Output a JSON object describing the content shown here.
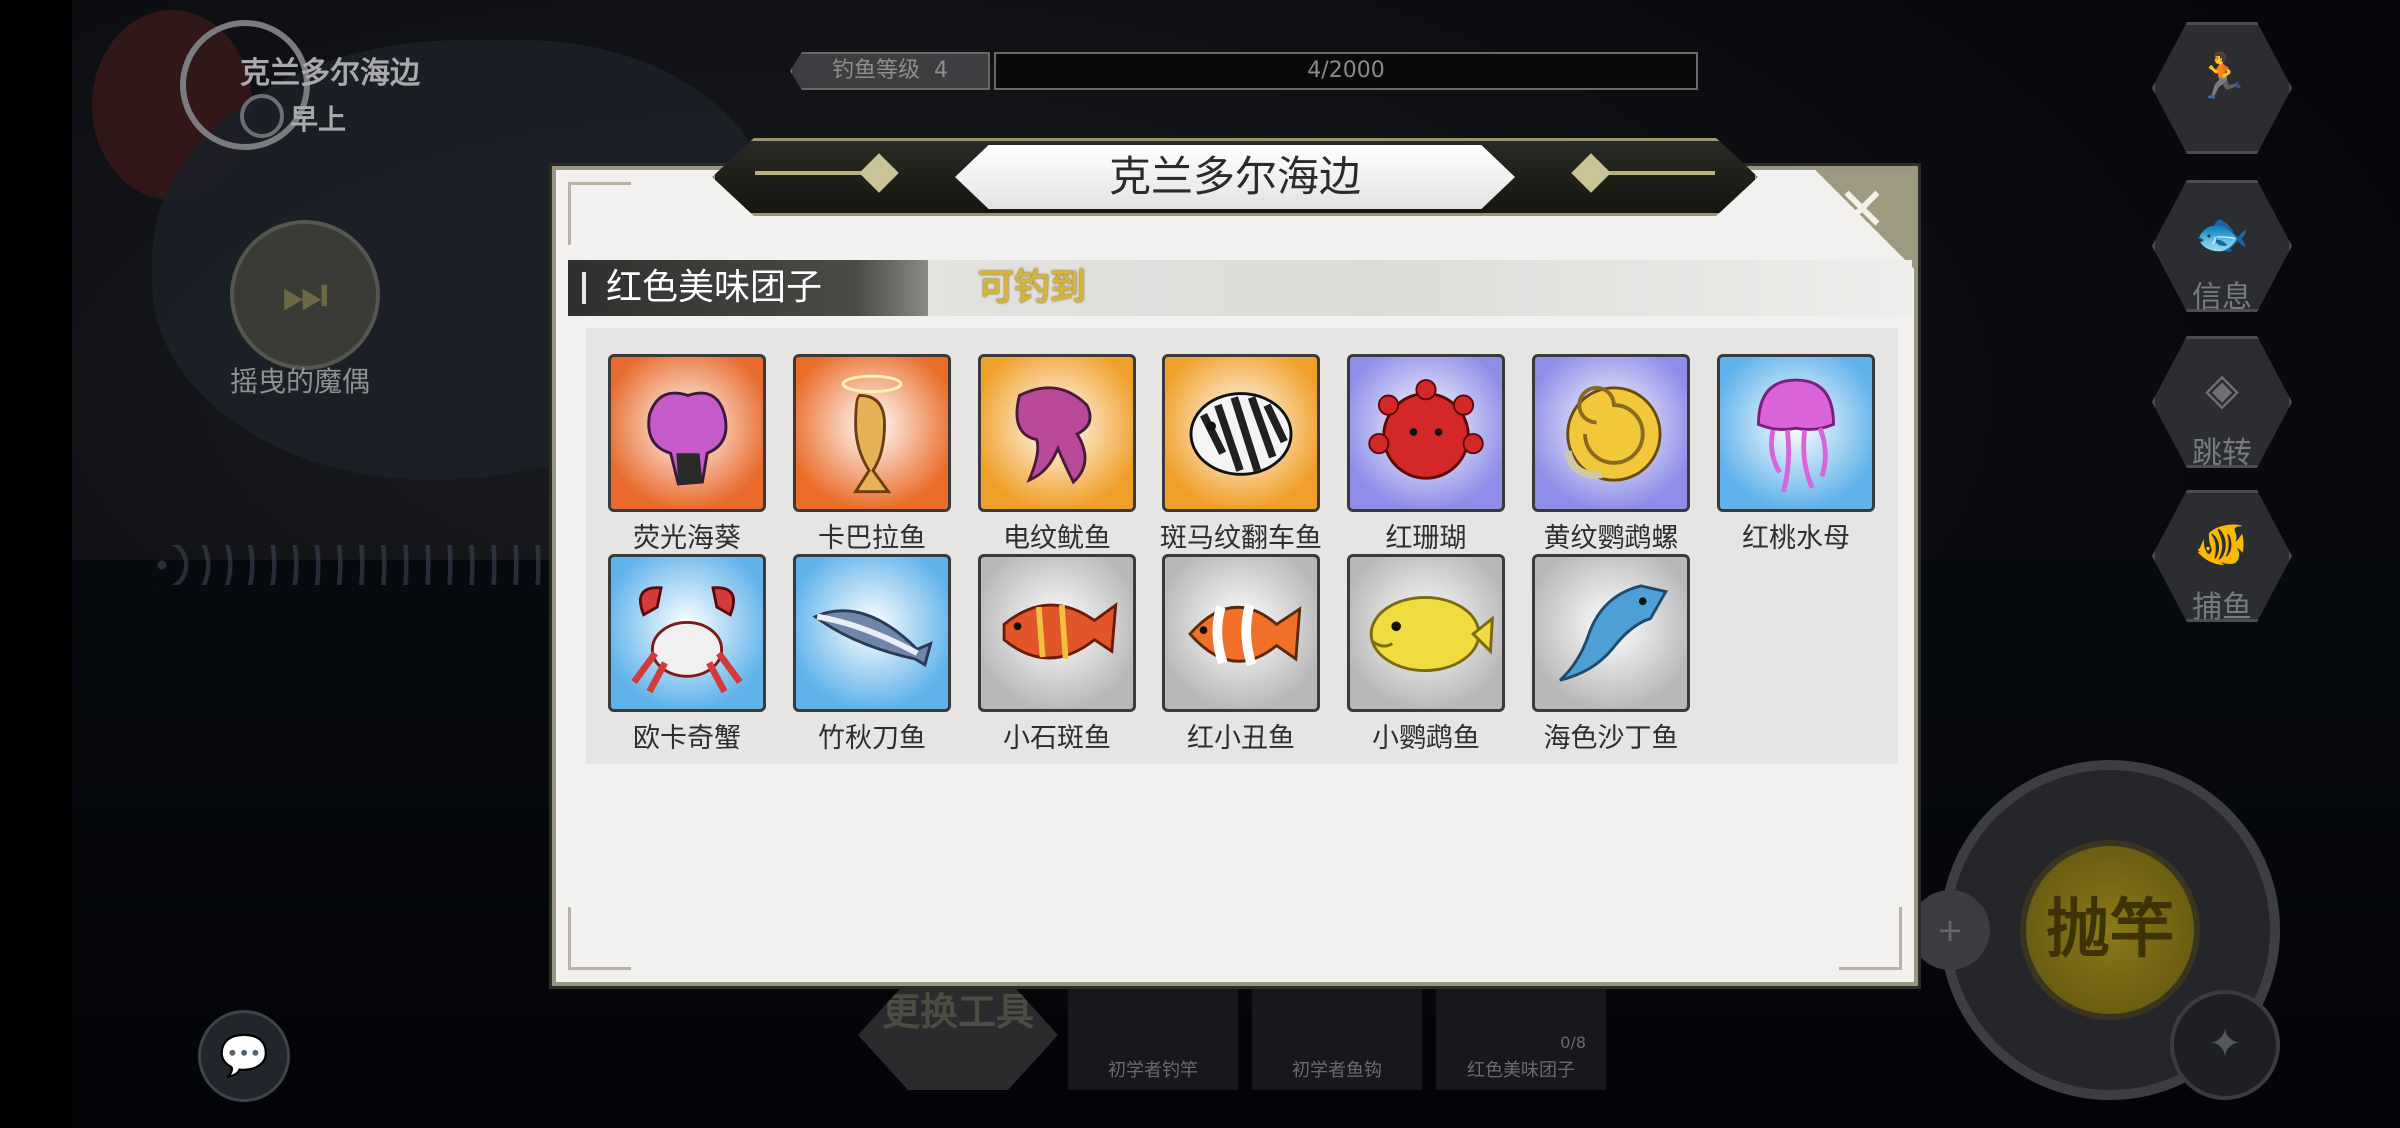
{
  "hud": {
    "location": "克兰多尔海边",
    "time_of_day": "早上",
    "level_label": "钓鱼等级",
    "level_value": "4",
    "progress_text": "4/2000",
    "music_title": "摇曳的魔偶",
    "side_buttons": [
      {
        "label": "",
        "icon": "run-icon"
      },
      {
        "label": "信息",
        "icon": "fish-info-icon"
      },
      {
        "label": "跳转",
        "icon": "crystal-icon"
      },
      {
        "label": "捕鱼",
        "icon": "catch-icon"
      }
    ],
    "tools_main_label": "更换工具",
    "tools": [
      {
        "label": "初学者钓竿"
      },
      {
        "label": "初学者鱼钩"
      },
      {
        "label": "红色美味团子",
        "count": "0/8"
      }
    ],
    "cast_label": "抛竿"
  },
  "modal": {
    "title": "克兰多尔海边",
    "bait_name": "红色美味团子",
    "catchable_label": "可钓到",
    "close_icon": "close-icon",
    "fish": [
      {
        "name": "荧光海葵",
        "bg": "#e86a2c",
        "rarity": "red",
        "icon": "anemone-icon",
        "color": "#c65ac8"
      },
      {
        "name": "卡巴拉鱼",
        "bg": "#ea6d2a",
        "rarity": "red",
        "icon": "kabbalah-fish-icon",
        "color": "#e7b257"
      },
      {
        "name": "电纹鱿鱼",
        "bg": "#f0a02a",
        "rarity": "gold",
        "icon": "squid-icon",
        "color": "#b94a9a"
      },
      {
        "name": "斑马纹翻车鱼",
        "bg": "#f0a02a",
        "rarity": "gold",
        "icon": "sunfish-icon",
        "color": "#202020"
      },
      {
        "name": "红珊瑚",
        "bg": "#8e8ee8",
        "rarity": "purple",
        "icon": "coral-icon",
        "color": "#d42828"
      },
      {
        "name": "黄纹鹦鹉螺",
        "bg": "#8e8ee8",
        "rarity": "purple",
        "icon": "nautilus-icon",
        "color": "#f0c83a"
      },
      {
        "name": "红桃水母",
        "bg": "#5fb2ea",
        "rarity": "blue",
        "icon": "jellyfish-icon",
        "color": "#d963d9"
      },
      {
        "name": "欧卡奇蟹",
        "bg": "#5fb2ea",
        "rarity": "blue",
        "icon": "crab-icon",
        "color": "#d43a3a"
      },
      {
        "name": "竹秋刀鱼",
        "bg": "#5fb2ea",
        "rarity": "blue",
        "icon": "saury-icon",
        "color": "#6f86a8"
      },
      {
        "name": "小石斑鱼",
        "bg": "#b8b8b8",
        "rarity": "gray",
        "icon": "grouper-icon",
        "color": "#e0552a"
      },
      {
        "name": "红小丑鱼",
        "bg": "#b8b8b8",
        "rarity": "gray",
        "icon": "clownfish-icon",
        "color": "#f0702a"
      },
      {
        "name": "小鹦鹉鱼",
        "bg": "#b8b8b8",
        "rarity": "gray",
        "icon": "parrotfish-icon",
        "color": "#f0dc40"
      },
      {
        "name": "海色沙丁鱼",
        "bg": "#b8b8b8",
        "rarity": "gray",
        "icon": "sardine-icon",
        "color": "#4d9fd6"
      }
    ]
  }
}
